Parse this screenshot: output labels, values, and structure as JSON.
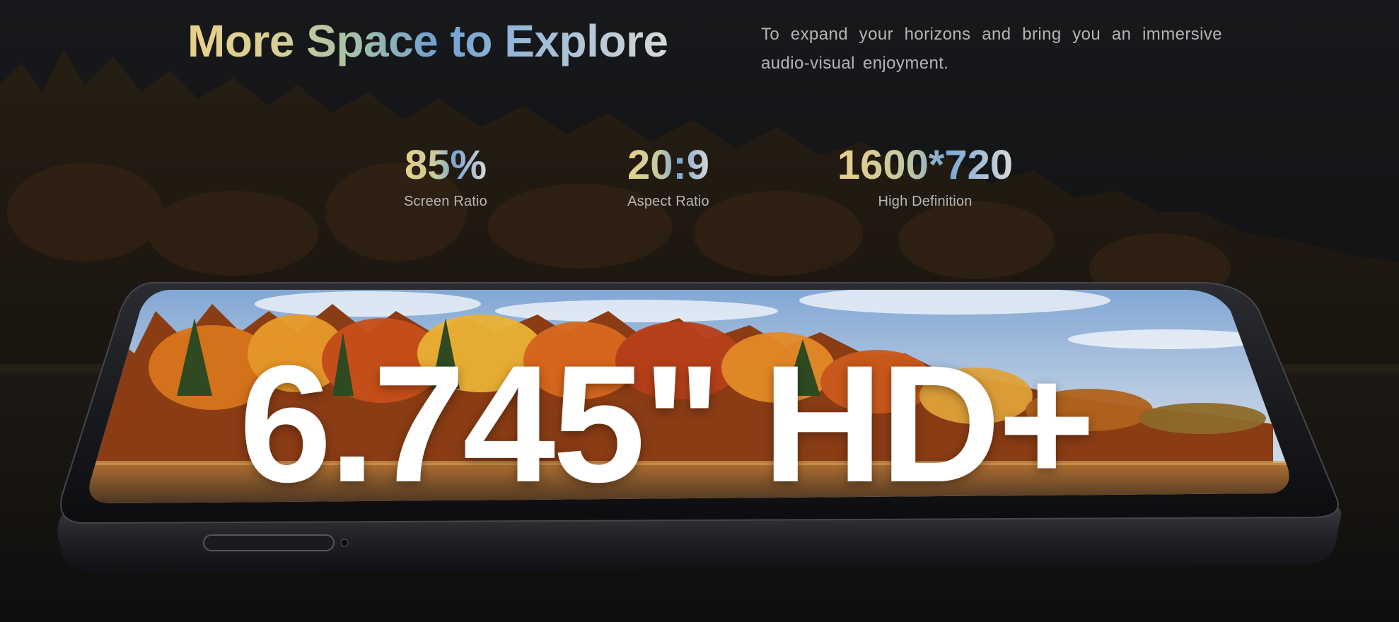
{
  "hero": {
    "headline": "More Space to Explore",
    "subtitle": "To expand your horizons and bring you an immersive audio-visual enjoyment."
  },
  "stats": [
    {
      "value": "85%",
      "label": "Screen Ratio"
    },
    {
      "value": "20:9",
      "label": "Aspect Ratio"
    },
    {
      "value": "1600*720",
      "label": "High Definition"
    }
  ],
  "phone": {
    "screen_text": "6.745\" HD+"
  }
}
